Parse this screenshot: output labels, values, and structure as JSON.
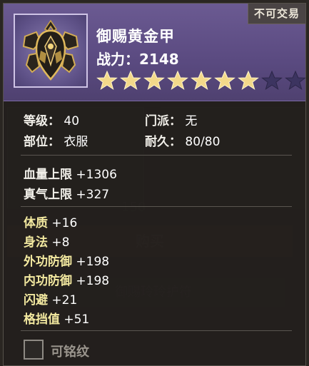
{
  "item": {
    "trade_badge": "不可交易",
    "name": "御赐黄金甲",
    "power_label": "战力：",
    "power_value": "2148",
    "stars_filled": 7,
    "stars_total": 9,
    "colors": {
      "header": "#5a4a80",
      "star_filled": "#f3d98a",
      "star_empty": "#3c3460",
      "gold_label": "#f3e9a0"
    },
    "icon": "golden-armor-icon"
  },
  "basic": {
    "level_label": "等级：",
    "level_value": "40",
    "school_label": "门派：",
    "school_value": "无",
    "slot_label": "部位：",
    "slot_value": "衣服",
    "durability_label": "耐久：",
    "durability_value": "80/80"
  },
  "base_stats": [
    {
      "label": "血量上限",
      "value": "+1306"
    },
    {
      "label": "真气上限",
      "value": "+327"
    }
  ],
  "attr_stats": [
    {
      "label": "体质",
      "value": "+16"
    },
    {
      "label": "身法",
      "value": "+8"
    },
    {
      "label": "外功防御",
      "value": "+198"
    },
    {
      "label": "内功防御",
      "value": "+198"
    },
    {
      "label": "闪避",
      "value": "+21"
    },
    {
      "label": "格挡值",
      "value": "+51"
    }
  ],
  "engrave": {
    "label": "可铭纹",
    "checked": false
  }
}
